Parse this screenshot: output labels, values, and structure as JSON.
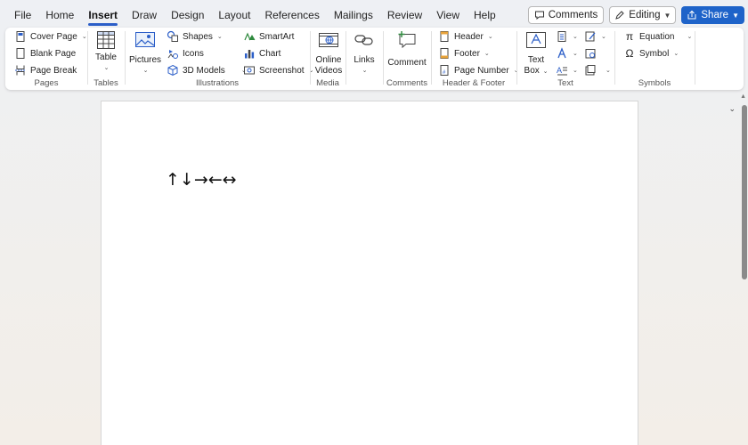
{
  "menu": {
    "tabs": [
      "File",
      "Home",
      "Insert",
      "Draw",
      "Design",
      "Layout",
      "References",
      "Mailings",
      "Review",
      "View",
      "Help"
    ],
    "active_tab": "Insert"
  },
  "actions": {
    "comments_label": "Comments",
    "editing_label": "Editing",
    "share_label": "Share"
  },
  "ribbon": {
    "pages": {
      "label": "Pages",
      "items": [
        "Cover Page",
        "Blank Page",
        "Page Break"
      ]
    },
    "tables": {
      "label": "Tables",
      "table_label": "Table"
    },
    "illustrations": {
      "label": "Illustrations",
      "pictures": "Pictures",
      "shapes": "Shapes",
      "icons": "Icons",
      "models": "3D Models",
      "smartart": "SmartArt",
      "chart": "Chart",
      "screenshot": "Screenshot"
    },
    "media": {
      "label": "Media",
      "online_videos_line1": "Online",
      "online_videos_line2": "Videos"
    },
    "links": {
      "label_button": "Links"
    },
    "comments": {
      "label": "Comments",
      "comment_button": "Comment"
    },
    "header_footer": {
      "label": "Header & Footer",
      "header": "Header",
      "footer": "Footer",
      "page_number": "Page Number"
    },
    "text": {
      "label": "Text",
      "textbox_line1": "Text",
      "textbox_line2": "Box"
    },
    "symbols": {
      "label": "Symbols",
      "equation": "Equation",
      "symbol": "Symbol"
    }
  },
  "document": {
    "content": "↑↓→←↔"
  },
  "colors": {
    "accent": "#2b5ec8",
    "share_bg": "#1e63c9"
  }
}
